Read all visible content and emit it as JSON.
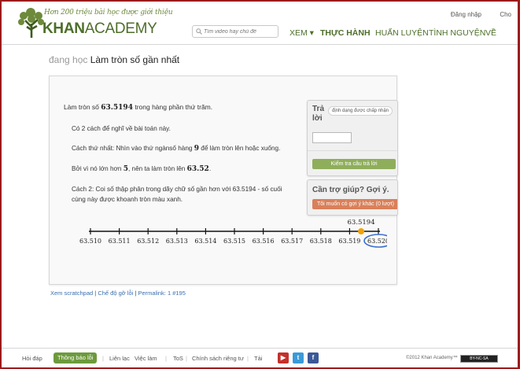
{
  "header": {
    "tagline": "Hơn 200 triệu bài học được giới thiệu",
    "logo_bold": "KHAN",
    "logo_rest": "ACADEMY",
    "login": "Đăng nhập",
    "donate": "Cho",
    "search_placeholder": "Tìm video hay chủ đề",
    "nav": {
      "watch": "XEM ▾",
      "practice": "THỰC HÀNH",
      "coach": "HUẤN LUYỆN",
      "volunteer": "TÌNH NGUYỆN",
      "about": "VỀ"
    }
  },
  "breadcrumb": {
    "prefix": "đang học",
    "title": "Làm tròn số gần nhất"
  },
  "problem": {
    "before": "Làm tròn số ",
    "number": "63.5194",
    "after": " trong hàng phần thứ trăm."
  },
  "hints": {
    "h1": "Có 2 cách để nghĩ về bài toán này.",
    "h2_pre": "Cách thứ nhất: Nhìn vào thứ ngànsố hàng ",
    "h2_num": "9",
    "h2_post": " để làm tròn lên hoặc xuống.",
    "h3_pre": "Bởi vì nó lớn hơn ",
    "h3_num": "5",
    "h3_mid": ", nên ta làm tròn lên ",
    "h3_num2": "63.52",
    "h3_post": ".",
    "h4_line1": "Cách 2: Coi số thập phân trong dãy chữ số gần hơn với 63.5194 - số cuối",
    "h4_line2": "cùng này được khoanh tròn màu xanh."
  },
  "number_line": {
    "marker_label": "63.5194",
    "marker_value": 63.5194,
    "ticks": [
      "63.510",
      "63.511",
      "63.512",
      "63.513",
      "63.514",
      "63.515",
      "63.516",
      "63.517",
      "63.518",
      "63.519",
      "63.520"
    ],
    "circled": "63.520",
    "marker_color": "#f0a30a",
    "circle_color": "#3a6fd0"
  },
  "answer": {
    "title": "Trả lời",
    "format_button": "định dạng được chấp nhận",
    "input_value": "",
    "check_button": "Kiểm tra câu trả lời"
  },
  "help": {
    "title": "Cần trợ giúp? Gợi ý.",
    "hint_button": "Tôi muốn có gợi ý khác (0 lượt)"
  },
  "sub_links": {
    "scratchpad": "Xem scratchpad",
    "debug": "Chế độ gỡ lỗi",
    "permalink": "Permalink: 1 #195",
    "sep": "|"
  },
  "footer": {
    "faq": "Hỏi đáp",
    "report": "Thông báo lỗi",
    "contact": "Liên lạc",
    "jobs": "Việc làm",
    "tos": "ToS",
    "privacy": "Chính sách riêng tư",
    "download": "Tải",
    "copyright": "©2012 Khan Academy™",
    "license": "BY-NC-SA",
    "sep": "|"
  },
  "colors": {
    "brand_green": "#4d6e2a",
    "check_green": "#8fae5c",
    "hint_orange": "#d9805a",
    "frame_red": "#9b1c1c",
    "link_blue": "#3a6fb0"
  }
}
